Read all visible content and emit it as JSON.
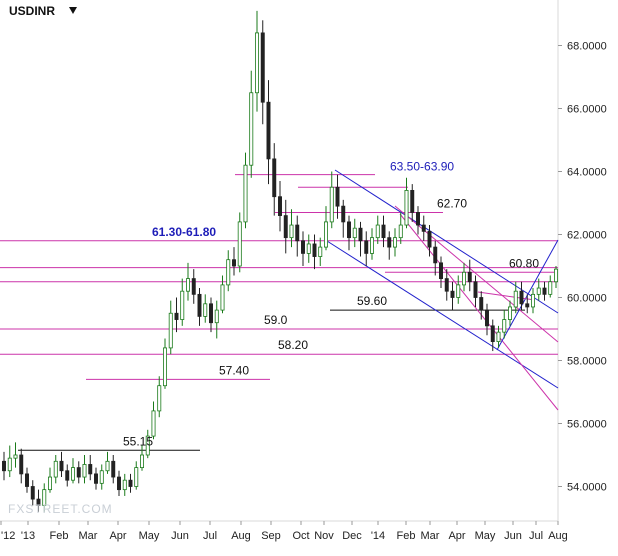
{
  "header": {
    "ticker": "USDINR",
    "dropdown_icon": "triangle-down-icon"
  },
  "watermark": "FXSTREET.COM",
  "colors": {
    "candle_up": "#1a7a1a",
    "candle_down": "#222222",
    "level_line": "#cc33aa",
    "channel": "#2222cc",
    "support_dark": "#111111",
    "axis": "#d9d9d9",
    "grid": "#eeeeee"
  },
  "chart_data": {
    "type": "candlestick",
    "title": "USDINR",
    "y_ticks": [
      "54.0000",
      "56.0000",
      "58.0000",
      "60.0000",
      "62.0000",
      "64.0000",
      "66.0000",
      "68.0000"
    ],
    "ylim": [
      52.8,
      69.2
    ],
    "x_ticks": [
      "'12",
      "'13",
      "Feb",
      "Mar",
      "Apr",
      "May",
      "Jun",
      "Jul",
      "Aug",
      "Sep",
      "Oct",
      "Nov",
      "Dec",
      "'14",
      "Feb",
      "Mar",
      "Apr",
      "May",
      "Jun",
      "Jul",
      "Aug"
    ],
    "grid": false,
    "levels": [
      {
        "label": "61.30-61.80",
        "value": 61.8,
        "style": "blue-bold"
      },
      {
        "label": "",
        "value": 60.95
      },
      {
        "label": "",
        "value": 60.5
      },
      {
        "label": "59.0",
        "value": 59.0
      },
      {
        "label": "58.20",
        "value": 58.2
      },
      {
        "label": "57.40",
        "value": 57.4
      },
      {
        "label": "63.50-63.90",
        "value": 63.9,
        "style": "blue"
      },
      {
        "label": "",
        "value": 63.5
      },
      {
        "label": "62.70",
        "value": 62.7
      },
      {
        "label": "60.80",
        "value": 60.8
      },
      {
        "label": "59.60",
        "value": 59.6
      },
      {
        "label": "55.15",
        "value": 55.15
      }
    ],
    "series": [
      {
        "values": [
          [
            54.8,
            54.5,
            55.1,
            54.2
          ],
          [
            54.5,
            54.9,
            55.3,
            54.3
          ],
          [
            54.9,
            55.0,
            55.4,
            54.6
          ],
          [
            55.0,
            54.4,
            55.2,
            54.1
          ],
          [
            54.4,
            54.0,
            54.6,
            53.8
          ],
          [
            54.0,
            53.6,
            54.2,
            53.4
          ],
          [
            53.6,
            53.4,
            53.9,
            53.2
          ],
          [
            53.4,
            53.9,
            54.1,
            53.2
          ],
          [
            53.9,
            54.3,
            54.6,
            53.8
          ],
          [
            54.3,
            54.8,
            55.0,
            54.1
          ],
          [
            54.8,
            54.5,
            55.1,
            54.3
          ],
          [
            54.5,
            54.2,
            54.7,
            54.0
          ],
          [
            54.2,
            54.6,
            54.9,
            54.1
          ],
          [
            54.6,
            54.3,
            54.8,
            54.1
          ],
          [
            54.3,
            54.7,
            55.0,
            54.1
          ],
          [
            54.7,
            54.4,
            55.0,
            54.2
          ],
          [
            54.4,
            54.1,
            54.6,
            53.9
          ],
          [
            54.1,
            54.5,
            54.7,
            53.9
          ],
          [
            54.5,
            54.8,
            55.1,
            54.4
          ],
          [
            54.8,
            54.3,
            55.0,
            54.1
          ],
          [
            54.3,
            53.9,
            54.5,
            53.7
          ],
          [
            53.9,
            54.2,
            54.4,
            53.7
          ],
          [
            54.2,
            54.0,
            54.4,
            53.8
          ],
          [
            54.0,
            54.6,
            54.8,
            53.9
          ],
          [
            54.6,
            55.0,
            55.3,
            54.5
          ],
          [
            55.0,
            55.6,
            55.8,
            54.9
          ],
          [
            55.6,
            56.4,
            56.7,
            55.5
          ],
          [
            56.4,
            57.2,
            57.5,
            56.2
          ],
          [
            57.2,
            58.4,
            58.7,
            57.1
          ],
          [
            58.4,
            59.5,
            59.9,
            58.2
          ],
          [
            59.5,
            59.3,
            60.0,
            58.9
          ],
          [
            59.3,
            60.2,
            60.6,
            59.1
          ],
          [
            60.2,
            60.6,
            61.1,
            59.9
          ],
          [
            60.6,
            60.1,
            60.9,
            59.8
          ],
          [
            60.1,
            59.4,
            60.3,
            59.1
          ],
          [
            59.4,
            59.8,
            60.1,
            59.2
          ],
          [
            59.8,
            59.2,
            60.0,
            58.9
          ],
          [
            59.2,
            59.6,
            59.9,
            58.7
          ],
          [
            59.6,
            60.4,
            60.7,
            59.5
          ],
          [
            60.4,
            61.2,
            61.5,
            60.2
          ],
          [
            61.2,
            61.0,
            61.6,
            60.7
          ],
          [
            61.0,
            62.4,
            62.7,
            60.8
          ],
          [
            62.4,
            64.2,
            64.6,
            62.2
          ],
          [
            64.2,
            66.5,
            67.2,
            63.8
          ],
          [
            66.5,
            68.4,
            69.1,
            65.9
          ],
          [
            68.4,
            66.2,
            68.8,
            65.5
          ],
          [
            66.2,
            64.4,
            66.9,
            63.6
          ],
          [
            64.4,
            63.2,
            64.9,
            62.6
          ],
          [
            63.2,
            62.6,
            63.7,
            62.1
          ],
          [
            62.6,
            61.9,
            63.1,
            61.4
          ],
          [
            61.9,
            62.3,
            62.8,
            61.6
          ],
          [
            62.3,
            61.8,
            62.6,
            61.3
          ],
          [
            61.8,
            61.4,
            62.1,
            61.0
          ],
          [
            61.4,
            61.7,
            62.0,
            61.1
          ],
          [
            61.7,
            61.3,
            62.0,
            60.9
          ],
          [
            61.3,
            61.6,
            61.9,
            61.0
          ],
          [
            61.6,
            62.4,
            62.9,
            61.5
          ],
          [
            62.4,
            63.5,
            64.0,
            62.2
          ],
          [
            63.5,
            62.9,
            63.9,
            62.5
          ],
          [
            62.9,
            62.4,
            63.1,
            61.9
          ],
          [
            62.4,
            61.9,
            62.6,
            61.5
          ],
          [
            61.9,
            62.2,
            62.5,
            61.6
          ],
          [
            62.2,
            61.8,
            62.4,
            61.3
          ],
          [
            61.8,
            61.4,
            62.1,
            61.0
          ],
          [
            61.4,
            61.9,
            62.2,
            61.2
          ],
          [
            61.9,
            62.3,
            62.6,
            61.7
          ],
          [
            62.3,
            61.9,
            62.6,
            61.6
          ],
          [
            61.9,
            61.6,
            62.1,
            61.2
          ],
          [
            61.6,
            61.9,
            62.2,
            61.3
          ],
          [
            61.9,
            62.3,
            62.7,
            61.7
          ],
          [
            62.3,
            63.4,
            63.8,
            62.2
          ],
          [
            63.4,
            62.7,
            63.6,
            62.4
          ],
          [
            62.7,
            62.3,
            62.9,
            62.0
          ],
          [
            62.3,
            62.1,
            62.6,
            61.8
          ],
          [
            62.1,
            61.6,
            62.3,
            61.3
          ],
          [
            61.6,
            61.1,
            61.8,
            60.7
          ],
          [
            61.1,
            60.6,
            61.3,
            60.3
          ],
          [
            60.6,
            60.2,
            60.9,
            59.9
          ],
          [
            60.2,
            60.0,
            60.5,
            59.6
          ],
          [
            60.0,
            60.4,
            60.7,
            59.8
          ],
          [
            60.4,
            60.8,
            61.1,
            60.2
          ],
          [
            60.8,
            60.5,
            61.2,
            60.2
          ],
          [
            60.5,
            60.0,
            60.7,
            59.7
          ],
          [
            60.0,
            59.6,
            60.2,
            59.3
          ],
          [
            59.6,
            59.1,
            59.8,
            58.8
          ],
          [
            59.1,
            58.6,
            59.3,
            58.3
          ],
          [
            58.6,
            58.9,
            59.1,
            58.4
          ],
          [
            58.9,
            59.3,
            59.6,
            58.7
          ],
          [
            59.3,
            59.7,
            59.9,
            59.1
          ],
          [
            59.7,
            60.2,
            60.5,
            59.5
          ],
          [
            60.2,
            59.8,
            60.5,
            59.6
          ],
          [
            59.8,
            59.7,
            60.1,
            59.5
          ],
          [
            59.7,
            60.1,
            60.3,
            59.5
          ],
          [
            60.1,
            60.3,
            60.6,
            59.9
          ],
          [
            60.3,
            60.1,
            60.5,
            59.9
          ],
          [
            60.1,
            60.5,
            60.7,
            60.0
          ],
          [
            60.5,
            60.9,
            61.0,
            60.3
          ]
        ]
      }
    ]
  }
}
